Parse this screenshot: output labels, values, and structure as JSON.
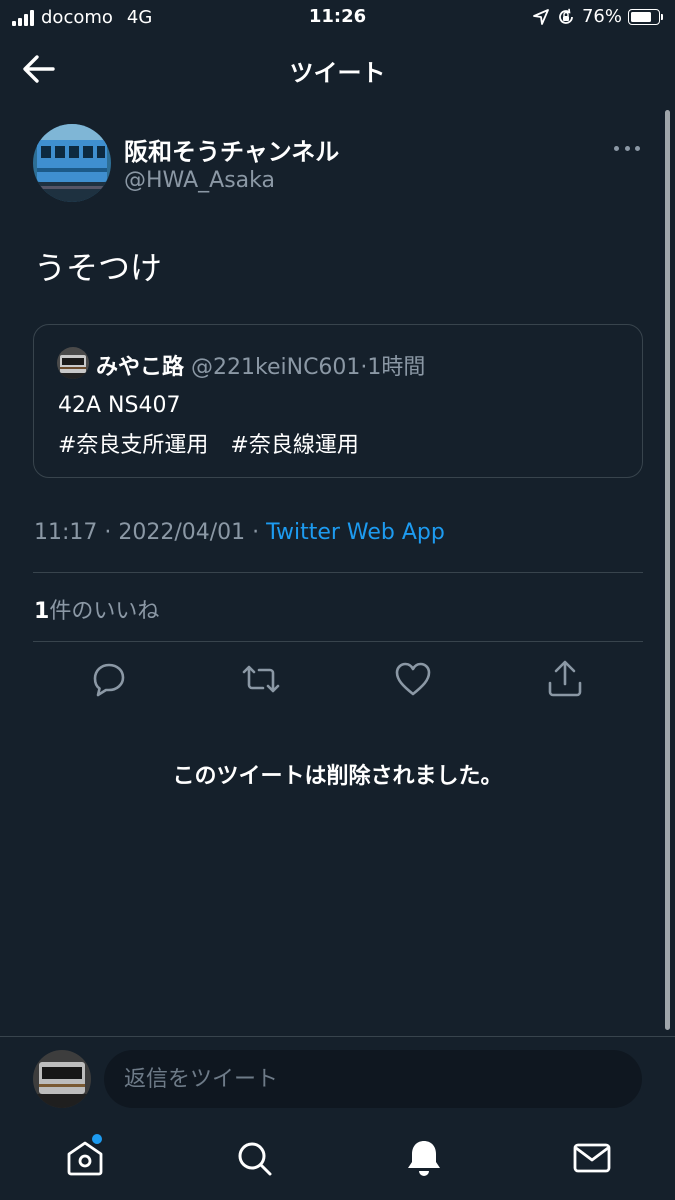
{
  "status_bar": {
    "carrier": "docomo",
    "network": "4G",
    "time": "11:26",
    "battery_percent": "76%",
    "battery_level": 0.76
  },
  "header": {
    "title": "ツイート"
  },
  "tweet": {
    "author_name": "阪和そうチャンネル",
    "author_handle": "@HWA_Asaka",
    "text": "うそつけ",
    "quote": {
      "name": "みやこ路",
      "handle": "@221keiNC601",
      "separator": "·",
      "time": "1時間",
      "line1": "42A NS407",
      "line2": "#奈良支所運用　#奈良線運用"
    },
    "timestamp": "11:17 · 2022/04/01 · ",
    "source_app": "Twitter Web App",
    "likes_count": "1",
    "likes_label": "件のいいね"
  },
  "deleted_message": "このツイートは削除されました。",
  "reply": {
    "placeholder": "返信をツイート"
  },
  "nav": [
    "home-icon",
    "search-icon",
    "bell-icon",
    "mail-icon"
  ],
  "colors": {
    "background": "#15202b",
    "accent": "#1d9bf0",
    "secondary_text": "#8b98a5",
    "border": "#38444d"
  }
}
